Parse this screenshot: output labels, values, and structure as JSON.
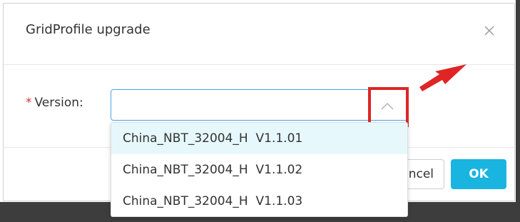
{
  "dialog": {
    "title": "GridProfile upgrade",
    "close_glyph": "×"
  },
  "form": {
    "required_mark": "*",
    "version_label": "Version:",
    "version_value": ""
  },
  "dropdown": {
    "options": [
      {
        "label": "China_NBT_32004_H  V1.1.01",
        "highlighted": true
      },
      {
        "label": "China_NBT_32004_H  V1.1.02",
        "highlighted": false
      },
      {
        "label": "China_NBT_32004_H  V1.1.03",
        "highlighted": false
      }
    ]
  },
  "footer": {
    "cancel_label": "Cancel",
    "ok_label": "OK"
  },
  "colors": {
    "accent": "#19b4e0",
    "annotation": "#e02525",
    "option_highlight": "#e6f8fb",
    "input_border_focus": "#4aa3e8"
  },
  "icons": {
    "close": "close-icon",
    "select_arrow": "chevron-up-icon",
    "annotation_arrow": "annotation-arrow-icon"
  }
}
